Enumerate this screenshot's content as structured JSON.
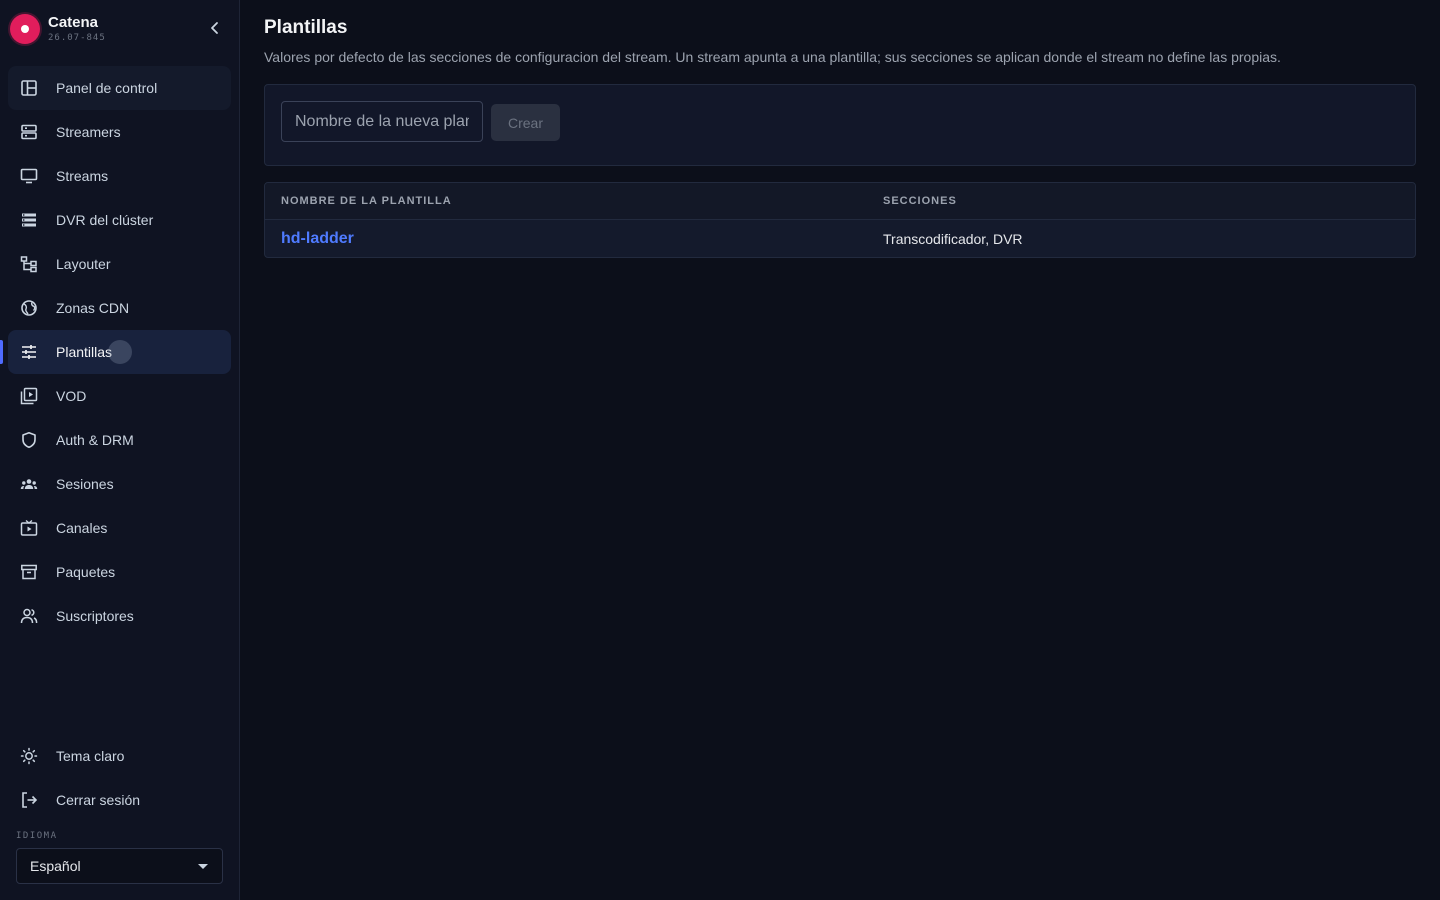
{
  "brand": {
    "name": "Catena",
    "version": "26.07-845",
    "accent": "#e11d5c"
  },
  "sidebar": {
    "collapse_icon": "chevron-left-icon",
    "items": [
      {
        "id": "panel",
        "label": "Panel de control",
        "icon": "dashboard-icon"
      },
      {
        "id": "streamers",
        "label": "Streamers",
        "icon": "server-icon"
      },
      {
        "id": "streams",
        "label": "Streams",
        "icon": "monitor-icon"
      },
      {
        "id": "dvr",
        "label": "DVR del clúster",
        "icon": "stack-icon"
      },
      {
        "id": "layouter",
        "label": "Layouter",
        "icon": "layout-tree-icon"
      },
      {
        "id": "cdn",
        "label": "Zonas CDN",
        "icon": "globe-icon"
      },
      {
        "id": "plantillas",
        "label": "Plantillas",
        "icon": "sliders-icon"
      },
      {
        "id": "vod",
        "label": "VOD",
        "icon": "video-library-icon"
      },
      {
        "id": "auth",
        "label": "Auth & DRM",
        "icon": "shield-icon"
      },
      {
        "id": "sesiones",
        "label": "Sesiones",
        "icon": "group-icon"
      },
      {
        "id": "canales",
        "label": "Canales",
        "icon": "tv-play-icon"
      },
      {
        "id": "paquetes",
        "label": "Paquetes",
        "icon": "archive-icon"
      },
      {
        "id": "suscriptores",
        "label": "Suscriptores",
        "icon": "users-icon"
      }
    ],
    "active": "Plantillas",
    "bottom": {
      "theme_label": "Tema claro",
      "logout_label": "Cerrar sesión"
    },
    "language": {
      "label": "IDIOMA",
      "selected": "Español"
    }
  },
  "main": {
    "title": "Plantillas",
    "description": "Valores por defecto de las secciones de configuracion del stream. Un stream apunta a una plantilla; sus secciones se aplican donde el stream no define las propias.",
    "create": {
      "placeholder": "Nombre de la nueva plantilla",
      "button_label": "Crear"
    },
    "table": {
      "columns": [
        "NOMBRE DE LA PLANTILLA",
        "SECCIONES"
      ],
      "rows": [
        {
          "name": "hd-ladder",
          "sections": "Transcodificador, DVR"
        }
      ]
    },
    "link_color": "#4f7bff",
    "active_indicator_color": "#4f6bff"
  }
}
